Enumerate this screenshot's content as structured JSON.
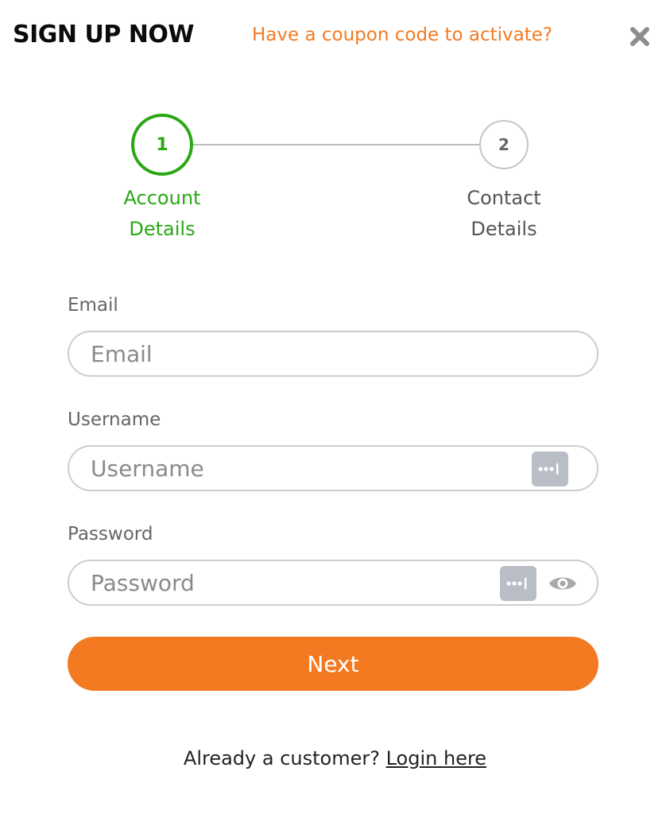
{
  "header": {
    "title": "SIGN UP NOW",
    "coupon_link": "Have a coupon code to activate?"
  },
  "stepper": {
    "steps": [
      {
        "number": "1",
        "label_line1": "Account",
        "label_line2": "Details",
        "state": "active"
      },
      {
        "number": "2",
        "label_line1": "Contact",
        "label_line2": "Details",
        "state": "inactive"
      }
    ]
  },
  "form": {
    "email": {
      "label": "Email",
      "placeholder": "Email",
      "value": ""
    },
    "username": {
      "label": "Username",
      "placeholder": "Username",
      "value": ""
    },
    "password": {
      "label": "Password",
      "placeholder": "Password",
      "value": ""
    }
  },
  "actions": {
    "next_label": "Next"
  },
  "footer": {
    "prompt": "Already a customer?",
    "login_link": "Login here"
  },
  "colors": {
    "accent": "#f37a21",
    "active_step": "#2aa814",
    "inactive_step": "#c4c4c4",
    "autofill_key": "#b8bdc6"
  },
  "icons": {
    "close": "close-icon",
    "autofill": "password-autofill-key-icon",
    "eye": "eye-icon"
  }
}
